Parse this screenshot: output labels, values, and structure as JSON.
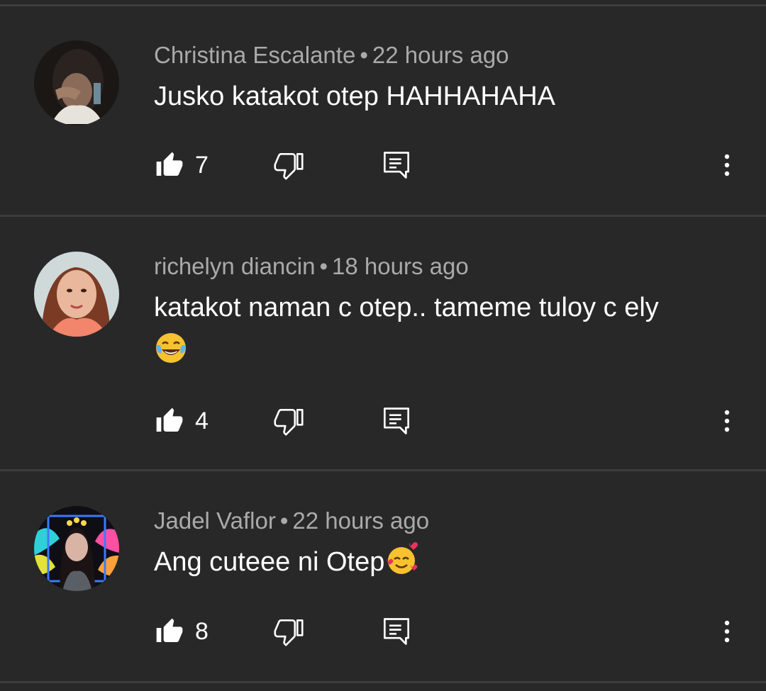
{
  "comments": [
    {
      "author": "Christina Escalante",
      "separator": "•",
      "time": "22 hours ago",
      "text": "Jusko katakot otep HAHHAHAHA",
      "likes": "7",
      "avatar": "avatar-photo"
    },
    {
      "author": "richelyn diancin",
      "separator": "•",
      "time": "18 hours ago",
      "text": "katakot naman c otep.. tameme tuloy c ely",
      "emoji": "face-with-tears-of-joy",
      "likes": "4",
      "avatar": "avatar-photo"
    },
    {
      "author": "Jadel Vaflor",
      "separator": "•",
      "time": "22 hours ago",
      "text": "Ang cuteee ni Otep",
      "emoji": "smiling-face-with-hearts",
      "likes": "8",
      "avatar": "avatar-photo"
    }
  ],
  "icons": {
    "like": "thumbs-up-icon",
    "dislike": "thumbs-down-icon",
    "reply": "reply-icon",
    "more": "more-vertical-icon"
  },
  "colors": {
    "background": "#282828",
    "divider": "#3d3d3d",
    "meta_text": "#aaaaaa",
    "body_text": "#ffffff"
  }
}
